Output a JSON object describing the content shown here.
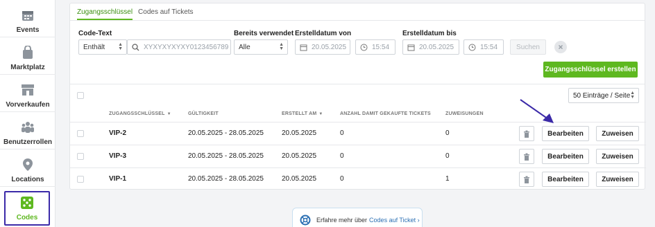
{
  "sidebar": {
    "items": [
      {
        "label": "Events",
        "icon": "calendar-icon"
      },
      {
        "label": "Marktplatz",
        "icon": "shopping-bag-icon"
      },
      {
        "label": "Vorverkaufen",
        "icon": "store-icon"
      },
      {
        "label": "Benutzerrollen",
        "icon": "users-icon"
      },
      {
        "label": "Locations",
        "icon": "location-pin-icon"
      },
      {
        "label": "Codes",
        "icon": "dice-icon",
        "active": true
      }
    ]
  },
  "tabs": [
    {
      "label": "Zugangsschlüssel",
      "active": true
    },
    {
      "label": "Codes auf Tickets"
    }
  ],
  "filters": {
    "code_text_label": "Code-Text",
    "code_text_mode": "Enthält",
    "code_text_placeholder": "XYXYXYXYXY0123456789",
    "used_label": "Bereits verwendet",
    "used_value": "Alle",
    "from_label": "Erstelldatum von",
    "from_date": "20.05.2025",
    "from_time": "15:54",
    "to_label": "Erstelldatum bis",
    "to_date": "20.05.2025",
    "to_time": "15:54",
    "search_label": "Suchen"
  },
  "create_button": "Zugangsschlüssel erstellen",
  "per_page": "50 Einträge / Seite",
  "table": {
    "headers": [
      "ZUGANGSSCHLÜSSEL",
      "GÜLTIGKEIT",
      "ERSTELLT AM",
      "ANZAHL DAMIT GEKAUFTE TICKETS",
      "ZUWEISUNGEN"
    ],
    "rows": [
      {
        "code": "VIP-2",
        "validity": "20.05.2025 - 28.05.2025",
        "created": "20.05.2025",
        "tickets": "0",
        "assignments": "0"
      },
      {
        "code": "VIP-3",
        "validity": "20.05.2025 - 28.05.2025",
        "created": "20.05.2025",
        "tickets": "0",
        "assignments": "0"
      },
      {
        "code": "VIP-1",
        "validity": "20.05.2025 - 28.05.2025",
        "created": "20.05.2025",
        "tickets": "0",
        "assignments": "1"
      }
    ],
    "edit_label": "Bearbeiten",
    "assign_label": "Zuweisen"
  },
  "info": {
    "text": "Erfahre mehr über",
    "link": "Codes auf Ticket"
  },
  "colors": {
    "accent": "#5eb820",
    "highlight": "#3b2aa8",
    "link": "#2b6fb3"
  }
}
